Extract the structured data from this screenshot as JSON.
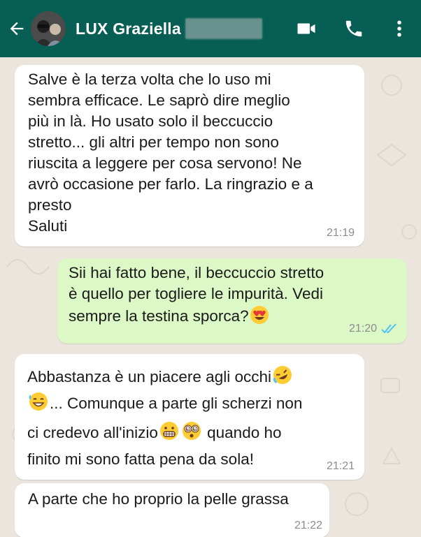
{
  "header": {
    "contact_name": "LUX Graziella",
    "icons": {
      "back": "arrow-left-icon",
      "video": "video-call-icon",
      "call": "phone-icon",
      "menu": "more-vert-icon"
    },
    "colors": {
      "bar": "#075e54",
      "text": "#ffffff"
    }
  },
  "messages": [
    {
      "direction": "incoming",
      "text": "Salve è la terza volta che lo uso mi\nsembra efficace. Le saprò dire meglio\npiù in là. Ho usato solo il beccuccio\nstretto... gli altri per tempo non sono\nriuscita a leggere per cosa servono! Ne\navrò occasione per farlo. La ringrazio e a\npresto\nSaluti",
      "time": "21:19"
    },
    {
      "direction": "outgoing",
      "line1": "Sii hai fatto bene, il beccuccio stretto",
      "line2": "è quello per togliere le impurità.  Vedi",
      "line3": "sempre la testina sporca?",
      "emoji": "heart-eyes-emoji",
      "time": "21:20",
      "status": "read-ticks-icon"
    },
    {
      "direction": "incoming",
      "line1": "Abbastanza è un piacere agli occhi",
      "line2": "... Comunque a parte gli scherzi non",
      "line3": "ci credevo all'inizio",
      "line3b": " quando ho",
      "line4": "finito mi sono fatta pena da sola!",
      "emojis": [
        "rolling-laughing-emoji",
        "sweat-smile-emoji",
        "grimacing-emoji",
        "dizzy-face-emoji"
      ],
      "time": "21:21"
    },
    {
      "direction": "incoming",
      "text": "A parte che ho proprio la pelle grassa",
      "time": "21:22"
    }
  ],
  "colors": {
    "chat_background": "#ece5dd",
    "incoming_bubble": "#ffffff",
    "outgoing_bubble": "#dcf8c6",
    "read_ticks": "#4fc3f7"
  }
}
